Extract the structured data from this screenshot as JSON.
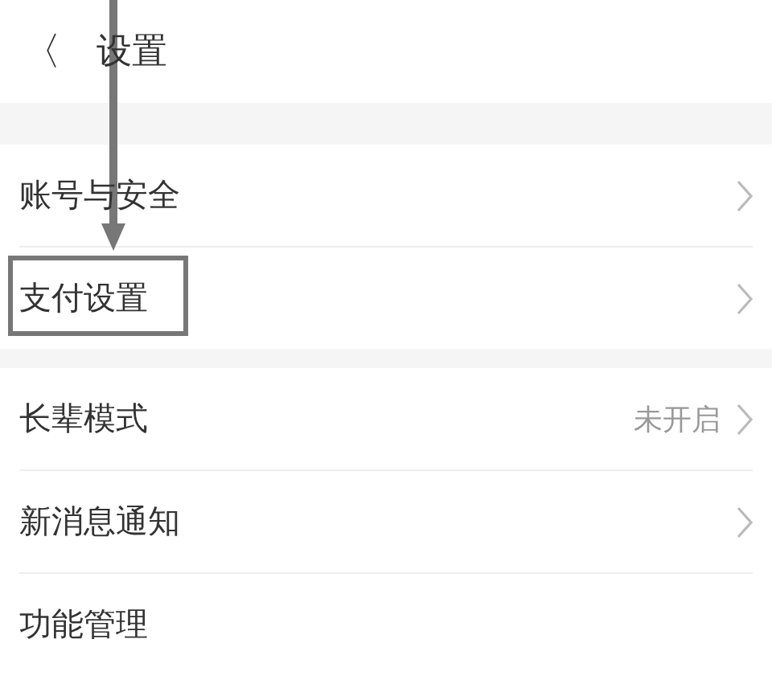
{
  "header": {
    "back_glyph": "〈",
    "title": "设置"
  },
  "groups": [
    {
      "rows": [
        {
          "label": "账号与安全",
          "chevron": true,
          "highlighted": false
        },
        {
          "label": "支付设置",
          "chevron": true,
          "highlighted": true
        }
      ]
    },
    {
      "rows": [
        {
          "label": "长辈模式",
          "value": "未开启",
          "chevron": true,
          "highlighted": false
        },
        {
          "label": "新消息通知",
          "chevron": true,
          "highlighted": false
        },
        {
          "label": "功能管理",
          "chevron": false,
          "highlighted": false
        }
      ]
    }
  ]
}
